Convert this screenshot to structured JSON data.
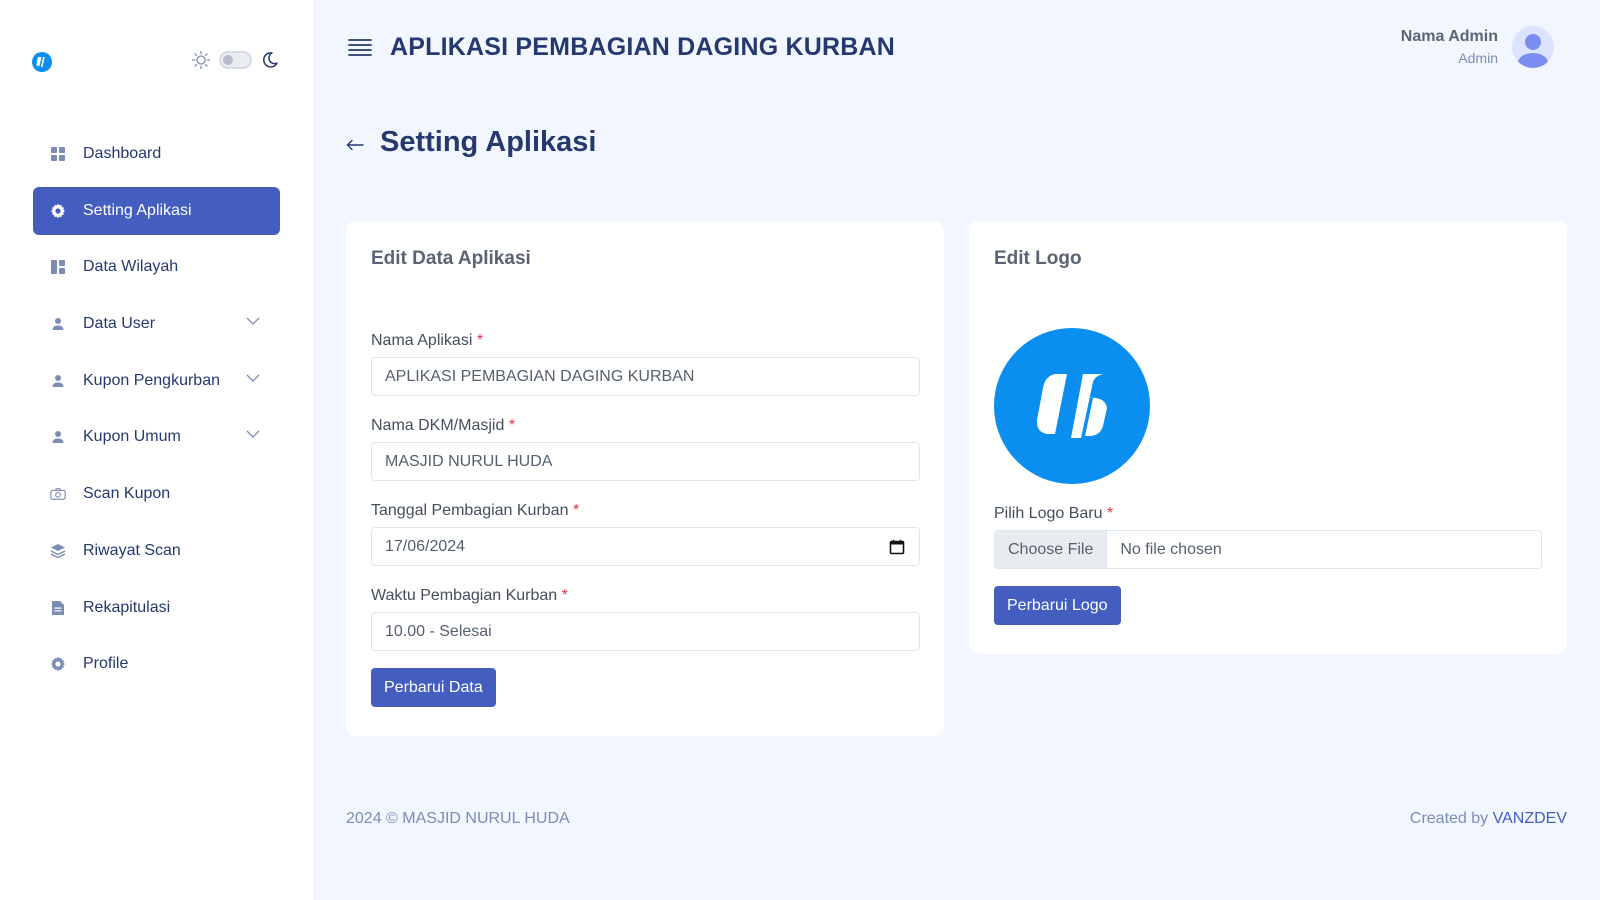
{
  "app": {
    "title": "APLIKASI PEMBAGIAN DAGING KURBAN"
  },
  "user": {
    "name": "Nama Admin",
    "role": "Admin"
  },
  "sidebar": {
    "items": [
      {
        "label": "Dashboard",
        "icon": "grid-icon"
      },
      {
        "label": "Setting Aplikasi",
        "icon": "gear-icon",
        "active": true
      },
      {
        "label": "Data Wilayah",
        "icon": "layout-icon"
      },
      {
        "label": "Data User",
        "icon": "person-icon",
        "has_submenu": true
      },
      {
        "label": "Kupon Pengkurban",
        "icon": "person-icon",
        "has_submenu": true
      },
      {
        "label": "Kupon Umum",
        "icon": "person-icon",
        "has_submenu": true
      },
      {
        "label": "Scan Kupon",
        "icon": "camera-icon"
      },
      {
        "label": "Riwayat Scan",
        "icon": "layers-icon"
      },
      {
        "label": "Rekapitulasi",
        "icon": "file-icon"
      },
      {
        "label": "Profile",
        "icon": "gear-icon"
      }
    ]
  },
  "page": {
    "title": "Setting Aplikasi"
  },
  "edit_data": {
    "title": "Edit Data Aplikasi",
    "fields": {
      "nama_aplikasi": {
        "label": "Nama Aplikasi",
        "required": "*",
        "value": "APLIKASI PEMBAGIAN DAGING KURBAN"
      },
      "nama_dkm": {
        "label": "Nama DKM/Masjid",
        "required": "*",
        "value": "MASJID NURUL HUDA"
      },
      "tanggal": {
        "label": "Tanggal Pembagian Kurban",
        "required": "*",
        "value": "17/06/2024"
      },
      "waktu": {
        "label": "Waktu Pembagian Kurban",
        "required": "*",
        "value": "10.00 - Selesai"
      }
    },
    "submit_label": "Perbarui Data"
  },
  "edit_logo": {
    "title": "Edit Logo",
    "file_label": "Pilih Logo Baru",
    "required": "*",
    "choose_label": "Choose File",
    "file_status": "No file chosen",
    "submit_label": "Perbarui Logo"
  },
  "footer": {
    "copyright": "2024 © MASJID NURUL HUDA",
    "created_by": "Created by",
    "author": "VANZDEV"
  },
  "colors": {
    "primary": "#435ebe",
    "brand": "#0a8ff0",
    "background": "#f2f7ff",
    "heading": "#25396f",
    "required": "#dc3545"
  }
}
